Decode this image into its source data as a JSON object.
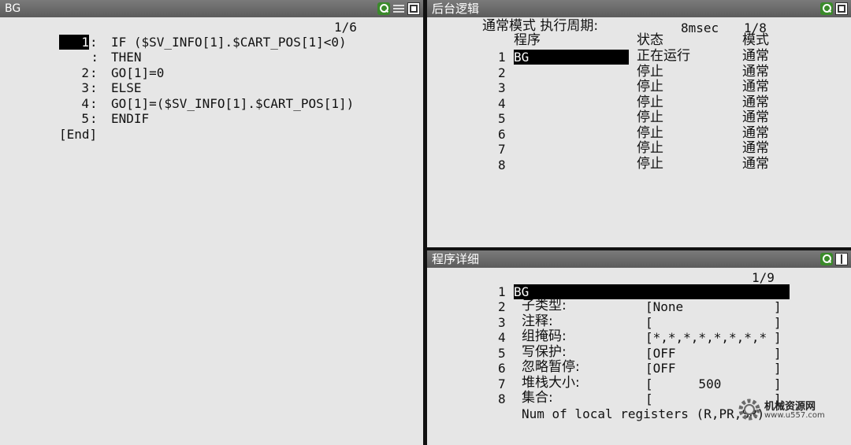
{
  "left": {
    "title": "BG",
    "page": "1/6",
    "lines": [
      {
        "num": "1",
        "sep": ":",
        "code": "IF ($SV_INFO[1].$CART_POS[1]<0)"
      },
      {
        "num": ":",
        "sep": "",
        "code": "THEN"
      },
      {
        "num": "2",
        "sep": ":",
        "code": "GO[1]=0"
      },
      {
        "num": "3",
        "sep": ":",
        "code": "ELSE"
      },
      {
        "num": "4",
        "sep": ":",
        "code": "GO[1]=($SV_INFO[1].$CART_POS[1])"
      },
      {
        "num": "5",
        "sep": ":",
        "code": "ENDIF"
      }
    ],
    "end": "[End]"
  },
  "bg_logic": {
    "title": "后台逻辑",
    "mode_label": "通常模式 执行周期:",
    "period": "8msec",
    "page": "1/8",
    "col_program": "程序",
    "col_status": "状态",
    "col_mode": "模式",
    "rows": [
      {
        "no": "1",
        "program": "BG",
        "status": "正在运行",
        "mode": "通常"
      },
      {
        "no": "2",
        "program": "",
        "status": "停止",
        "mode": "通常"
      },
      {
        "no": "3",
        "program": "",
        "status": "停止",
        "mode": "通常"
      },
      {
        "no": "4",
        "program": "",
        "status": "停止",
        "mode": "通常"
      },
      {
        "no": "5",
        "program": "",
        "status": "停止",
        "mode": "通常"
      },
      {
        "no": "6",
        "program": "",
        "status": "停止",
        "mode": "通常"
      },
      {
        "no": "7",
        "program": "",
        "status": "停止",
        "mode": "通常"
      },
      {
        "no": "8",
        "program": "",
        "status": "停止",
        "mode": "通常"
      }
    ]
  },
  "detail": {
    "title": "程序详细",
    "page": "1/9",
    "name_no": "1",
    "name": "BG",
    "fields": [
      {
        "no": "2",
        "label": "子类型:",
        "value": "[None"
      },
      {
        "no": "3",
        "label": "注释:",
        "value": "["
      },
      {
        "no": "4",
        "label": "组掩码:",
        "value": "[*,*,*,*,*,*,*,*"
      },
      {
        "no": "5",
        "label": "写保护:",
        "value": "[OFF"
      },
      {
        "no": "6",
        "label": "忽略暂停:",
        "value": "[OFF"
      },
      {
        "no": "7",
        "label": "堆栈大小:",
        "value": "[      500"
      },
      {
        "no": "8",
        "label": "集合:",
        "value": "["
      }
    ],
    "footer": "Num of local registers (R,PR,SR)"
  },
  "watermark": {
    "line1": "机械资源网",
    "line2": "www.u557.com"
  }
}
